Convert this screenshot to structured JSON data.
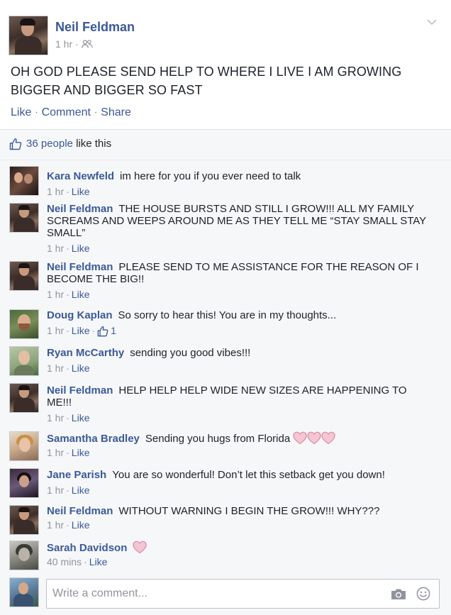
{
  "post": {
    "author": "Neil Feldman",
    "time": "1 hr",
    "meta_sep": "·",
    "audience_icon": "friends-icon",
    "text": "OH GOD PLEASE SEND HELP TO WHERE I LIVE I AM GROWING BIGGER AND BIGGER SO FAST",
    "actions": {
      "like": "Like",
      "comment": "Comment",
      "share": "Share",
      "sep": " · "
    }
  },
  "likes": {
    "count": "36 people",
    "suffix": " like this"
  },
  "comments": [
    {
      "name": "Kara Newfeld",
      "text": "im here for you if you ever need to talk",
      "time": "1 hr",
      "like": "Like",
      "avatar": "kara"
    },
    {
      "name": "Neil Feldman",
      "text": "THE HOUSE BURSTS AND STILL I GROW!!! ALL MY FAMILY SCREAMS AND WEEPS AROUND ME AS THEY TELL ME “STAY SMALL STAY SMALL”",
      "time": "1 hr",
      "like": "Like",
      "avatar": "neil"
    },
    {
      "name": "Neil Feldman",
      "text": "PLEASE SEND TO ME ASSISTANCE FOR THE REASON OF I BECOME THE BIG!!",
      "time": "1 hr",
      "like": "Like",
      "avatar": "neil"
    },
    {
      "name": "Doug Kaplan",
      "text": "So sorry to hear this! You are in my thoughts...",
      "time": "1 hr",
      "like": "Like",
      "like_count": "1",
      "avatar": "doug"
    },
    {
      "name": "Ryan McCarthy",
      "text": "sending you good vibes!!!",
      "time": "1 hr",
      "like": "Like",
      "avatar": "ryan"
    },
    {
      "name": "Neil Feldman",
      "text": "HELP HELP HELP WIDE NEW SIZES ARE HAPPENING TO ME!!!",
      "time": "1 hr",
      "like": "Like",
      "avatar": "neil"
    },
    {
      "name": "Samantha Bradley",
      "text": "Sending you hugs from Florida",
      "hearts": 3,
      "time": "1 hr",
      "like": "Like",
      "avatar": "sam"
    },
    {
      "name": "Jane Parish",
      "text": "You are so wonderful! Don’t let this setback get you down!",
      "time": "1 hr",
      "like": "Like",
      "avatar": "jane"
    },
    {
      "name": "Neil Feldman",
      "text": "WITHOUT WARNING I BEGIN THE GROW!!! WHY???",
      "time": "1 hr",
      "like": "Like",
      "avatar": "neil"
    },
    {
      "name": "Sarah Davidson",
      "text": "",
      "hearts": 1,
      "time": "40 mins",
      "like": "Like",
      "avatar": "sarah"
    }
  ],
  "composer": {
    "placeholder": "Write a comment...",
    "camera_icon": "camera-icon",
    "emoji_icon": "smile-icon"
  },
  "colors": {
    "link": "#3b5998",
    "meta": "#90949c",
    "text": "#1d2129",
    "heart_fill": "#f4c6d4",
    "heart_stroke": "#d98aa4"
  }
}
